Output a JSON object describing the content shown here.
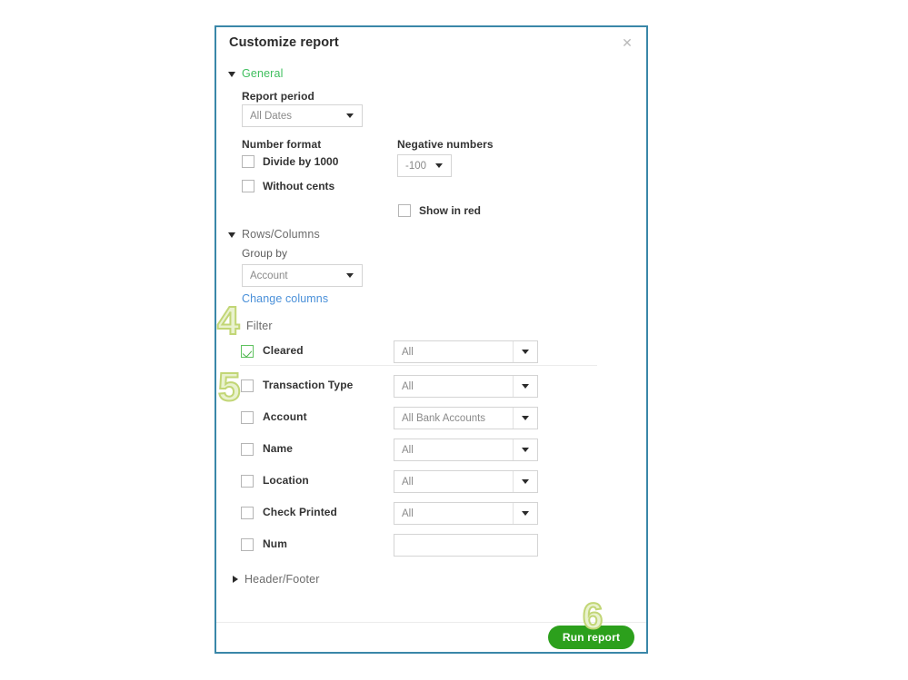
{
  "panel": {
    "title": "Customize report",
    "close_icon": "close-icon",
    "close_glyph": "✕"
  },
  "general": {
    "section_label": "General",
    "report_period_label": "Report period",
    "report_period_value": "All Dates",
    "number_format_label": "Number format",
    "divide_by_1000_label": "Divide by 1000",
    "divide_by_1000_checked": false,
    "without_cents_label": "Without cents",
    "without_cents_checked": false,
    "negative_numbers_label": "Negative numbers",
    "negative_numbers_value": "-100",
    "show_in_red_label": "Show in red",
    "show_in_red_checked": false
  },
  "rows_columns": {
    "section_label": "Rows/Columns",
    "group_by_label": "Group by",
    "group_by_value": "Account",
    "change_columns_link": "Change columns"
  },
  "filter": {
    "section_label": "Filter",
    "rows": [
      {
        "label": "Cleared",
        "checked": true,
        "value": "All",
        "control": "select"
      },
      {
        "label": "Transaction Type",
        "checked": false,
        "value": "All",
        "control": "select"
      },
      {
        "label": "Account",
        "checked": false,
        "value": "All Bank Accounts",
        "control": "select"
      },
      {
        "label": "Name",
        "checked": false,
        "value": "All",
        "control": "select"
      },
      {
        "label": "Location",
        "checked": false,
        "value": "All",
        "control": "select"
      },
      {
        "label": "Check Printed",
        "checked": false,
        "value": "All",
        "control": "select"
      },
      {
        "label": "Num",
        "checked": false,
        "value": "",
        "control": "text"
      }
    ]
  },
  "header_footer": {
    "section_label": "Header/Footer"
  },
  "footer": {
    "run_report_label": "Run report"
  },
  "annotations": [
    {
      "number": "4"
    },
    {
      "number": "5"
    },
    {
      "number": "6"
    }
  ],
  "colors": {
    "panel_border": "#3a87a8",
    "accent_green": "#2ca01c",
    "section_green": "#3fbf5e",
    "link_blue": "#4a90d9",
    "annotation_fill": "#e9f2cf",
    "annotation_stroke": "#c2d676"
  }
}
